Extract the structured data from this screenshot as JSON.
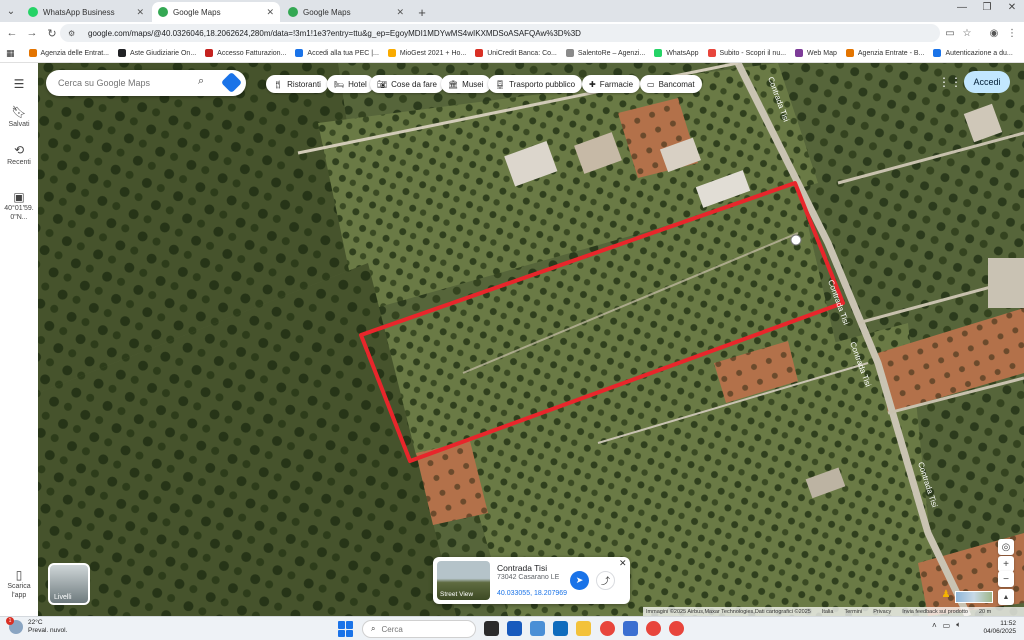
{
  "browser": {
    "tabs": [
      {
        "title": "WhatsApp Business",
        "icon": "whatsapp-icon",
        "color": "#25d366",
        "active": false
      },
      {
        "title": "Google Maps",
        "icon": "maps-pin-icon",
        "color": "#34a853",
        "active": true
      },
      {
        "title": "Google Maps",
        "icon": "maps-pin-icon",
        "color": "#34a853",
        "active": false
      }
    ],
    "new_tab": "+",
    "url": "google.com/maps/@40.0326046,18.2062624,280m/data=!3m1!1e3?entry=ttu&g_ep=EgoyMDI1MDYwMS4wIKXMDSoASAFQAw%3D%3D",
    "bookmarks": [
      {
        "label": "Agenzia delle Entrat...",
        "color": "#e37400"
      },
      {
        "label": "Aste Giudiziarie On...",
        "color": "#202124"
      },
      {
        "label": "Accesso Fatturazion...",
        "color": "#c5221f"
      },
      {
        "label": "Accedi alla tua PEC |...",
        "color": "#1a73e8"
      },
      {
        "label": "MioGest 2021 + Ho...",
        "color": "#f9ab00"
      },
      {
        "label": "UniCredit Banca: Co...",
        "color": "#d93025"
      },
      {
        "label": "SalentoRe – Agenzi...",
        "color": "#8a8a8a"
      },
      {
        "label": "WhatsApp",
        "color": "#25d366"
      },
      {
        "label": "Subito - Scopri il nu...",
        "color": "#e8453c"
      },
      {
        "label": "Web Map",
        "color": "#7d3c98"
      },
      {
        "label": "Agenzia Entrate - B...",
        "color": "#e37400"
      },
      {
        "label": "Autenticazione a du...",
        "color": "#1a73e8"
      }
    ]
  },
  "rail": {
    "saved": "Salvati",
    "recent": "Recenti",
    "coords_short": "40°01'59.\n0\"N...",
    "download_app": "Scarica\nl'app"
  },
  "search": {
    "placeholder": "Cerca su Google Maps"
  },
  "chips": [
    {
      "label": "Ristoranti",
      "icon": "restaurant-icon"
    },
    {
      "label": "Hotel",
      "icon": "hotel-icon"
    },
    {
      "label": "Cose da fare",
      "icon": "camera-icon"
    },
    {
      "label": "Musei",
      "icon": "museum-icon"
    },
    {
      "label": "Trasporto pubblico",
      "icon": "transit-icon"
    },
    {
      "label": "Farmacie",
      "icon": "pharmacy-icon"
    },
    {
      "label": "Bancomat",
      "icon": "atm-icon"
    }
  ],
  "accedi": "Accedi",
  "layers_label": "Livelli",
  "map_labels": [
    "Contrada Tisi",
    "Contrada Tisi",
    "Contrada Tisi",
    "Contrada Tisi"
  ],
  "card": {
    "title": "Contrada Tisi",
    "address": "73042 Casarano LE",
    "coords": "40.033055, 18.207969",
    "street_view": "Street View"
  },
  "attribution": {
    "text": "Immagini ©2025 Airbus,Maxar Technologies,Dati cartografici ©2025",
    "italia": "Italia",
    "terms": "Termini",
    "privacy": "Privacy",
    "feedback": "Invia feedback sul prodotto",
    "scale": "20 m"
  },
  "taskbar": {
    "temp": "22°C",
    "weather": "Preval. nuvol.",
    "weather_badge": "1",
    "search_label": "Cerca",
    "time": "11:52",
    "date": "04/06/2025"
  },
  "colors": {
    "boundary": "#e8262b",
    "accent": "#1a73e8"
  }
}
